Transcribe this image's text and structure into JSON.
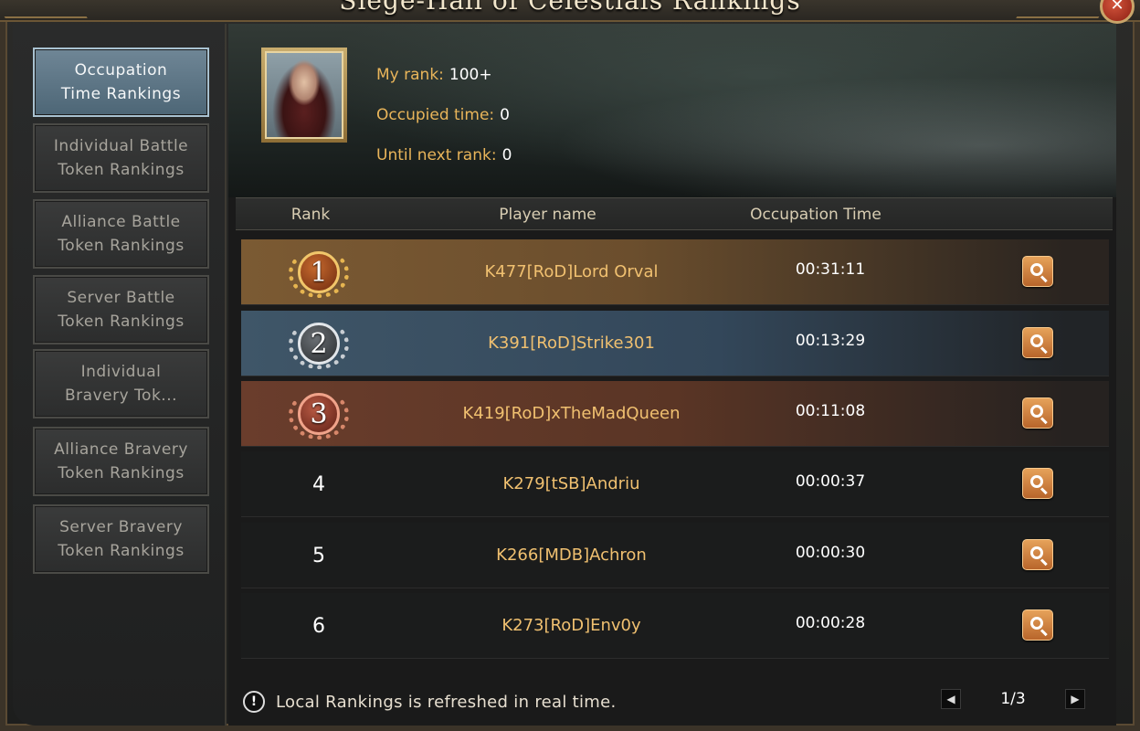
{
  "window": {
    "title": "Siege-Hall of Celestials Rankings",
    "close_symbol": "✕"
  },
  "sidebar": {
    "items": [
      {
        "label": "Occupation\nTime Rankings",
        "active": true
      },
      {
        "label": "Individual Battle\nToken Rankings",
        "active": false
      },
      {
        "label": "Alliance Battle\nToken Rankings",
        "active": false
      },
      {
        "label": "Server Battle\nToken Rankings",
        "active": false
      },
      {
        "label": "Individual\nBravery Tok...",
        "active": false
      },
      {
        "label": "Alliance Bravery\nToken Rankings",
        "active": false
      },
      {
        "label": "Server Bravery\nToken Rankings",
        "active": false
      }
    ]
  },
  "my_stats": {
    "rank_label": "My rank:",
    "rank_value": "100+",
    "occupied_label": "Occupied time:",
    "occupied_value": "0",
    "next_label": "Until next rank:",
    "next_value": "0"
  },
  "table": {
    "headers": {
      "rank": "Rank",
      "player": "Player name",
      "time": "Occupation Time"
    },
    "rows": [
      {
        "rank": "1",
        "medal": "gold",
        "name": "K477[RoD]Lord Orval",
        "time": "00:31:11"
      },
      {
        "rank": "2",
        "medal": "silver",
        "name": "K391[RoD]Strike301",
        "time": "00:13:29"
      },
      {
        "rank": "3",
        "medal": "bronze",
        "name": "K419[RoD]xTheMadQueen",
        "time": "00:11:08"
      },
      {
        "rank": "4",
        "medal": "",
        "name": "K279[tSB]Andriu",
        "time": "00:00:37"
      },
      {
        "rank": "5",
        "medal": "",
        "name": "K266[MDB]Achron",
        "time": "00:00:30"
      },
      {
        "rank": "6",
        "medal": "",
        "name": "K273[RoD]Env0y",
        "time": "00:00:28"
      }
    ]
  },
  "footer": {
    "info_symbol": "!",
    "note": "Local Rankings is refreshed in real time.",
    "pager": {
      "prev": "◀",
      "next": "▶",
      "label": "1/3"
    }
  },
  "colors": {
    "accent_gold": "#e9b55a",
    "search_button": "#c9783a",
    "active_tab": "#5f7888"
  }
}
